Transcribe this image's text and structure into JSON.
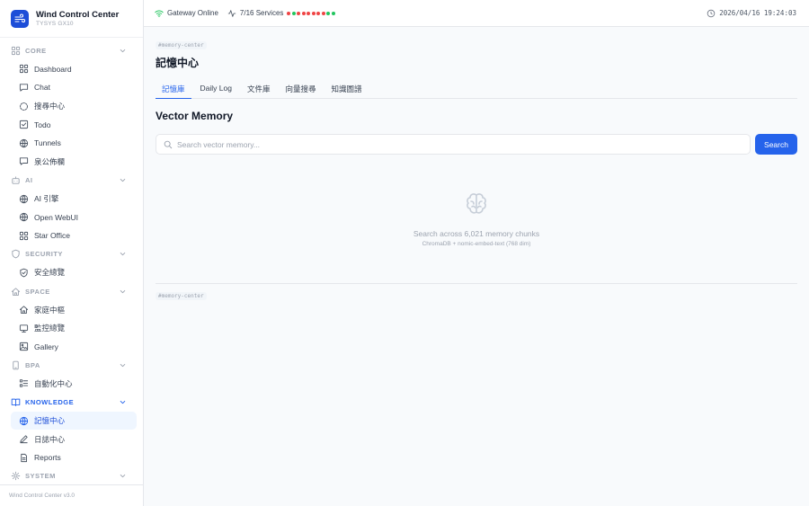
{
  "brand": {
    "title": "Wind Control Center",
    "subtitle": "TYSYS GX10"
  },
  "sidebar": {
    "sections": [
      {
        "label": "CORE",
        "icon": "grid-icon",
        "items": [
          {
            "label": "Dashboard",
            "icon": "grid-icon"
          },
          {
            "label": "Chat",
            "icon": "chat-icon"
          },
          {
            "label": "搜尋中心",
            "icon": "search-circle-icon"
          },
          {
            "label": "Todo",
            "icon": "checkbox-icon"
          },
          {
            "label": "Tunnels",
            "icon": "globe-icon"
          },
          {
            "label": "泉公佈欄",
            "icon": "message-icon"
          }
        ]
      },
      {
        "label": "AI",
        "icon": "robot-icon",
        "items": [
          {
            "label": "AI 引擎",
            "icon": "globe-icon"
          },
          {
            "label": "Open WebUI",
            "icon": "globe-icon"
          },
          {
            "label": "Star Office",
            "icon": "grid-icon"
          }
        ]
      },
      {
        "label": "SECURITY",
        "icon": "shield-icon",
        "items": [
          {
            "label": "安全總覽",
            "icon": "shield-check-icon"
          }
        ]
      },
      {
        "label": "SPACE",
        "icon": "home-icon",
        "items": [
          {
            "label": "家庭中樞",
            "icon": "home-icon"
          },
          {
            "label": "監控總覽",
            "icon": "monitor-icon"
          },
          {
            "label": "Gallery",
            "icon": "image-icon"
          }
        ]
      },
      {
        "label": "BPA",
        "icon": "phone-icon",
        "items": [
          {
            "label": "自動化中心",
            "icon": "list-icon"
          }
        ]
      },
      {
        "label": "KNOWLEDGE",
        "icon": "book-icon",
        "active": true,
        "items": [
          {
            "label": "記憶中心",
            "icon": "globe-icon",
            "active": true
          },
          {
            "label": "日誌中心",
            "icon": "pen-icon"
          },
          {
            "label": "Reports",
            "icon": "file-icon"
          }
        ]
      },
      {
        "label": "SYSTEM",
        "icon": "gear-icon",
        "items": []
      }
    ],
    "footer": "Wind Control Center v3.0"
  },
  "topbar": {
    "gateway": "Gateway Online",
    "services": "7/16 Services",
    "service_status": [
      "#ef4444",
      "#22c55e",
      "#ef4444",
      "#ef4444",
      "#ef4444",
      "#ef4444",
      "#ef4444",
      "#ef4444",
      "#22c55e",
      "#22c55e"
    ],
    "clock": "2026/04/16 19:24:03"
  },
  "main": {
    "route_tag": "#memory-center",
    "page_title": "記憶中心",
    "tabs": [
      "記憶庫",
      "Daily Log",
      "文件庫",
      "向量搜尋",
      "知識圖譜"
    ],
    "active_tab": 0,
    "section_title": "Vector Memory",
    "search": {
      "placeholder": "Search vector memory...",
      "value": "",
      "button": "Search"
    },
    "empty_state": {
      "icon": "brain-icon",
      "title": "Search across 6,021 memory chunks",
      "subtitle": "ChromaDB + nomic-embed-text (768 dim)"
    },
    "route_tag_bottom": "#memory-center"
  },
  "colors": {
    "accent": "#2563eb",
    "online": "#22c55e",
    "offline": "#ef4444"
  }
}
